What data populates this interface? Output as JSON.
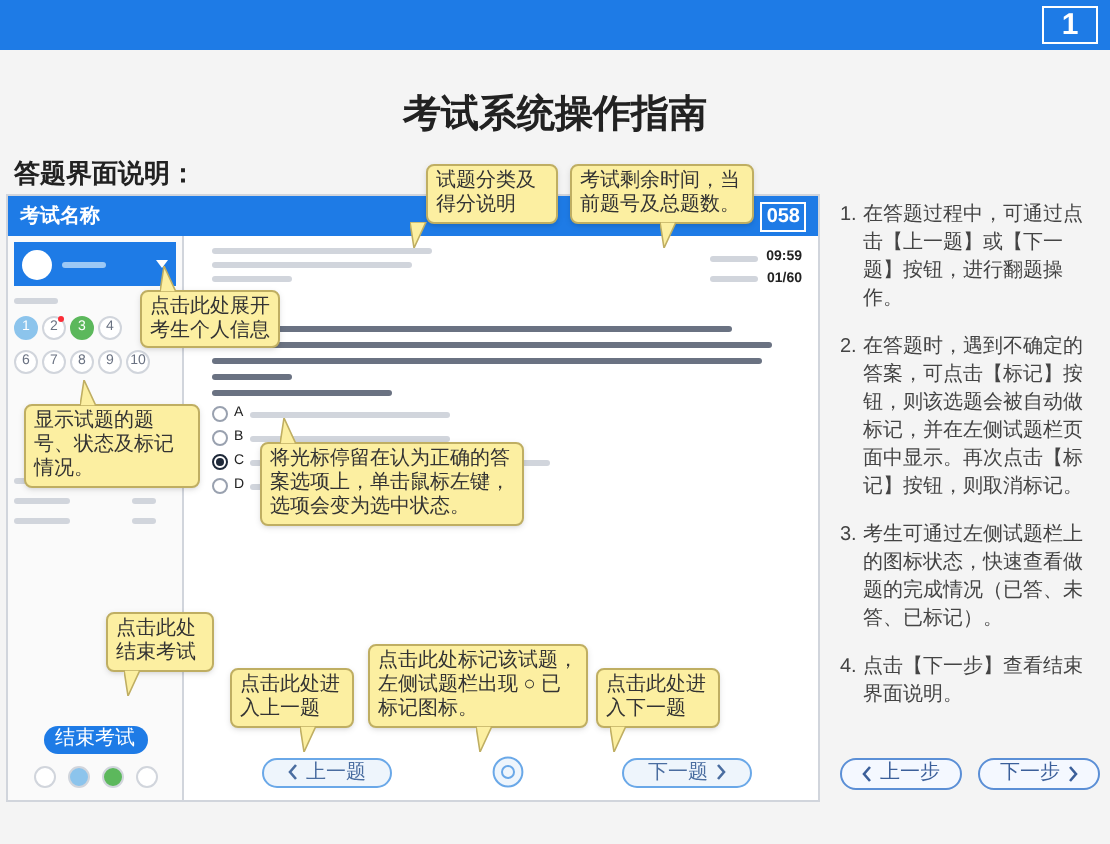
{
  "header": {
    "page_number": "1"
  },
  "title": "考试系统操作指南",
  "section_label": "答题界面说明：",
  "mock": {
    "exam_name": "考试名称",
    "question_number": "058",
    "time_left": "09:59",
    "progress": "01/60",
    "question_rows": [
      [
        {
          "number": "1",
          "selected": true,
          "answered": false,
          "marked": false
        },
        {
          "number": "2",
          "selected": false,
          "answered": false,
          "marked": true
        },
        {
          "number": "3",
          "selected": false,
          "answered": true,
          "marked": false
        },
        {
          "number": "4",
          "selected": false,
          "answered": false,
          "marked": false
        }
      ],
      [
        {
          "number": "6",
          "selected": false,
          "answered": false,
          "marked": false
        },
        {
          "number": "7",
          "selected": false,
          "answered": false,
          "marked": false
        },
        {
          "number": "8",
          "selected": false,
          "answered": false,
          "marked": false
        },
        {
          "number": "9",
          "selected": false,
          "answered": false,
          "marked": false
        },
        {
          "number": "10",
          "selected": false,
          "answered": false,
          "marked": false
        }
      ]
    ],
    "options": [
      {
        "letter": "A",
        "selected": false
      },
      {
        "letter": "B",
        "selected": false
      },
      {
        "letter": "C",
        "selected": true
      },
      {
        "letter": "D",
        "selected": false
      }
    ],
    "end_button": "结束考试",
    "prev_button": "上一题",
    "next_button": "下一题"
  },
  "callouts": [
    "试题分类及得分说明",
    "考试剩余时间，当前题号及总题数。",
    "点击此处展开考生个人信息",
    "显示试题的题号、状态及标记情况。",
    "将光标停留在认为正确的答案选项上，单击鼠标左键，选项会变为选中状态。",
    "点击此处结束考试",
    "点击此处进入上一题",
    "点击此处标记该试题，左侧试题栏出现 ○ 已标记图标。",
    "点击此处进入下一题"
  ],
  "instructions": [
    {
      "number": "1.",
      "text": "在答题过程中，可通过点击【上一题】或【下一题】按钮，进行翻题操作。"
    },
    {
      "number": "2.",
      "text": "在答题时，遇到不确定的答案，可点击【标记】按钮，则该选题会被自动做标记，并在左侧试题栏页面中显示。再次点击【标记】按钮，则取消标记。"
    },
    {
      "number": "3.",
      "text": "考生可通过左侧试题栏上的图标状态，快速查看做题的完成情况（已答、未答、已标记）。"
    },
    {
      "number": "4.",
      "text": "点击【下一步】查看结束界面说明。"
    }
  ],
  "nav": {
    "prev": "上一步",
    "next": "下一步"
  }
}
